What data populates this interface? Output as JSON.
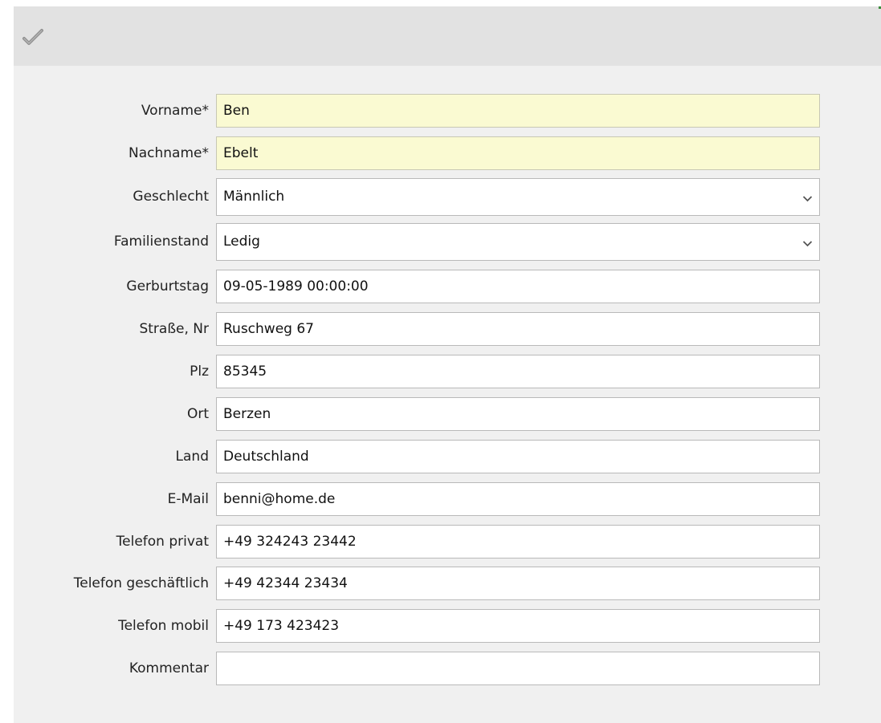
{
  "toolbar": {
    "confirm_icon": "checkmark-icon"
  },
  "form": {
    "fields": [
      {
        "label": "Vorname*",
        "value": "Ben",
        "kind": "text",
        "required": true
      },
      {
        "label": "Nachname*",
        "value": "Ebelt",
        "kind": "text",
        "required": true
      },
      {
        "label": "Geschlecht",
        "value": "Männlich",
        "kind": "select",
        "required": false
      },
      {
        "label": "Familienstand",
        "value": "Ledig",
        "kind": "select",
        "required": false
      },
      {
        "label": "Gerburtstag",
        "value": "09-05-1989 00:00:00",
        "kind": "text",
        "required": false
      },
      {
        "label": "Straße, Nr",
        "value": "Ruschweg 67",
        "kind": "text",
        "required": false
      },
      {
        "label": "Plz",
        "value": "85345",
        "kind": "text",
        "required": false
      },
      {
        "label": "Ort",
        "value": "Berzen",
        "kind": "text",
        "required": false
      },
      {
        "label": "Land",
        "value": "Deutschland",
        "kind": "text",
        "required": false
      },
      {
        "label": "E-Mail",
        "value": "benni@home.de",
        "kind": "text",
        "required": false
      },
      {
        "label": "Telefon privat",
        "value": "+49 324243 23442",
        "kind": "text",
        "required": false
      },
      {
        "label": "Telefon geschäftlich",
        "value": "+49 42344 23434",
        "kind": "text",
        "required": false
      },
      {
        "label": "Telefon mobil",
        "value": "+49 173 423423",
        "kind": "text",
        "required": false
      },
      {
        "label": "Kommentar",
        "value": "",
        "kind": "text",
        "required": false
      }
    ]
  },
  "colors": {
    "required_field_bg": "#fafad2",
    "panel_bg": "#f0f0f0",
    "toolbar_bg": "#e2e2e2"
  }
}
